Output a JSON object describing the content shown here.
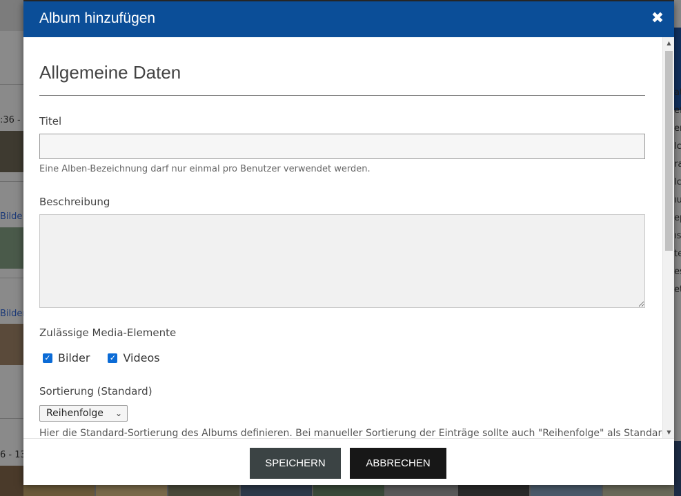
{
  "modal": {
    "title": "Album hinzufügen",
    "close_icon": "✖",
    "section_title": "Allgemeine Daten",
    "fields": {
      "title_label": "Titel",
      "title_value": "",
      "title_help": "Eine Alben-Bezeichnung darf nur einmal pro Benutzer verwendet werden.",
      "description_label": "Beschreibung",
      "description_value": "",
      "media_label": "Zulässige Media-Elemente",
      "media_options": [
        {
          "label": "Bilder",
          "checked": true
        },
        {
          "label": "Videos",
          "checked": true
        }
      ],
      "sort_label": "Sortierung (Standard)",
      "sort_value": "Reihenfolge",
      "sort_help": "Hier die Standard-Sortierung des Albums definieren. Bei manueller Sortierung der Einträge sollte auch \"Reihenfolge\" als Standard"
    },
    "buttons": {
      "save": "SPEICHERN",
      "cancel": "ABBRECHEN"
    }
  },
  "background": {
    "left_texts": [
      ":36 -",
      "Bilde",
      "Bilder",
      "6 - 13"
    ],
    "right_letters": "at ef er lc ra lc ıu ep ıs te es et"
  },
  "colors": {
    "header": "#0b4e98",
    "checkbox": "#0b6bd6",
    "save_button": "#3b4344",
    "cancel_button": "#171717"
  },
  "icons": {
    "close": "close-icon",
    "checkbox": "checkbox-checked-icon",
    "dropdown": "chevron-down-icon",
    "scroll_up": "scroll-up-arrow-icon",
    "scroll_down": "scroll-down-arrow-icon"
  }
}
